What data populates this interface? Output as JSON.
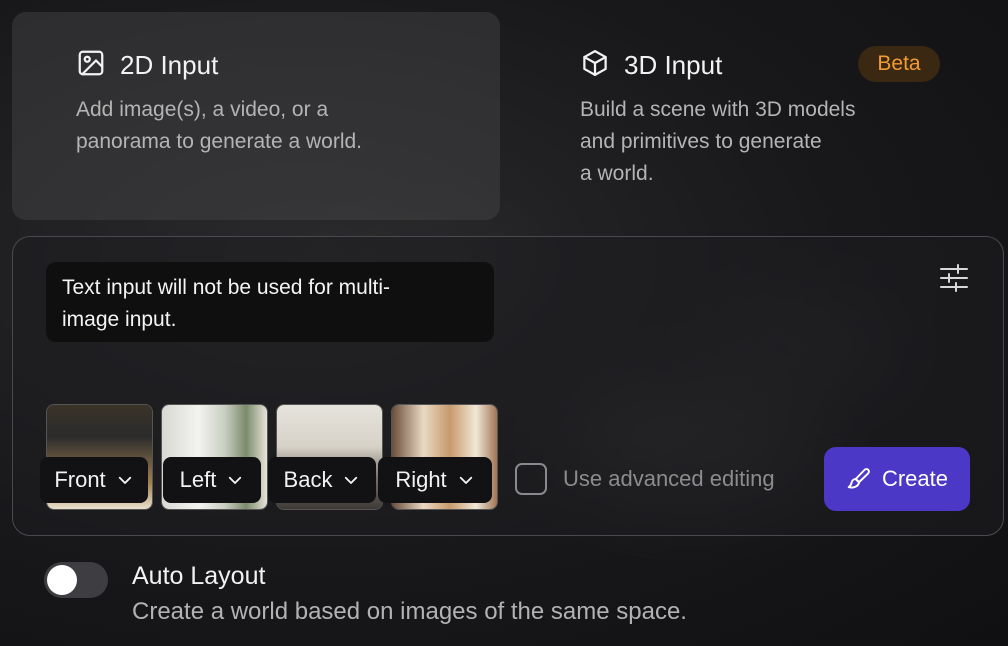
{
  "modes": {
    "input_2d": {
      "title": "2D Input",
      "icon": "image-icon",
      "description_line1": "Add image(s), a video, or a",
      "description_line2": "panorama to generate a world."
    },
    "input_3d": {
      "title": "3D Input",
      "icon": "cube-icon",
      "badge": "Beta",
      "description_line1": "Build a scene with 3D models",
      "description_line2": "and primitives to generate",
      "description_line3": "a world."
    }
  },
  "prompt_panel": {
    "tooltip_line1": "Text input will not be used for multi-",
    "tooltip_line2": "image input.",
    "settings_icon": "sliders-icon",
    "images": [
      {
        "direction": "Front"
      },
      {
        "direction": "Left"
      },
      {
        "direction": "Back"
      },
      {
        "direction": "Right"
      }
    ],
    "advanced_editing_label": "Use advanced editing",
    "advanced_editing_checked": false,
    "create_label": "Create",
    "create_icon": "brush-icon"
  },
  "auto_layout": {
    "title": "Auto Layout",
    "description": "Create a world based on images of the same space.",
    "enabled": false
  },
  "colors": {
    "accent": "#4b38c7",
    "beta_text": "#f29a35",
    "beta_bg": "#3b2812"
  }
}
